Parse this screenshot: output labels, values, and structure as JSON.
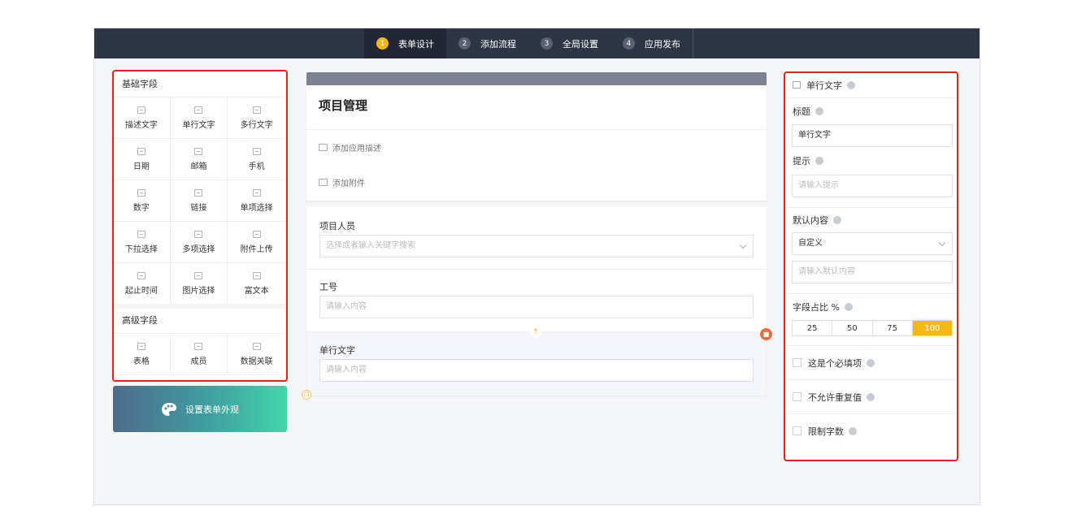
{
  "steps": [
    {
      "num": "1",
      "label": "表单设计"
    },
    {
      "num": "2",
      "label": "添加流程"
    },
    {
      "num": "3",
      "label": "全局设置"
    },
    {
      "num": "4",
      "label": "应用发布"
    }
  ],
  "basic_fields": {
    "title": "基础字段",
    "items": [
      "描述文字",
      "单行文字",
      "多行文字",
      "日期",
      "邮箱",
      "手机",
      "数字",
      "链接",
      "单项选择",
      "下拉选择",
      "多项选择",
      "附件上传",
      "起止时间",
      "图片选择",
      "富文本"
    ]
  },
  "advanced_fields": {
    "title": "高级字段",
    "items": [
      "表格",
      "成员",
      "数据关联"
    ]
  },
  "appearance_button": "设置表单外观",
  "form_header": {
    "title": "项目管理",
    "add_description": "添加应用描述",
    "add_attachment": "添加附件"
  },
  "form_fields": [
    {
      "label": "项目人员",
      "placeholder": "选择或者输入关键字搜索"
    },
    {
      "label": "工号",
      "placeholder": "请输入内容"
    },
    {
      "label": "单行文字",
      "placeholder": "请输入内容"
    }
  ],
  "properties": {
    "field_type": "单行文字",
    "title_label": "标题",
    "title_value": "单行文字",
    "hint_label": "提示",
    "hint_placeholder": "请输入提示",
    "default_label": "默认内容",
    "default_mode": "自定义",
    "default_placeholder": "请输入默认内容",
    "ratio_label": "字段占比 %",
    "ratio_options": [
      "25",
      "50",
      "75",
      "100"
    ],
    "ratio_selected": "100",
    "required_label": "这是个必填项",
    "no_duplicate_label": "不允许重复值",
    "limit_length_label": "限制字数"
  },
  "colors": {
    "accent": "#f5b914",
    "topbar": "#2e3543",
    "highlight_box": "#f01e1e",
    "delete": "#ee6a3d"
  }
}
